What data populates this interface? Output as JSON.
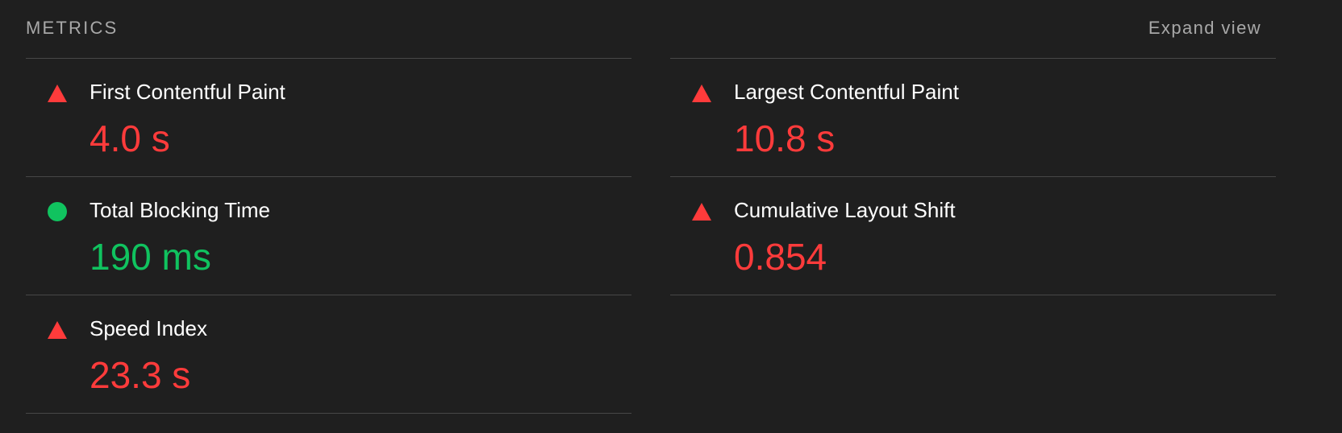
{
  "header": {
    "title": "METRICS",
    "expand_label": "Expand view"
  },
  "colors": {
    "fail": "#ff3b3b",
    "pass": "#10c35f",
    "background": "#1f1f1f",
    "divider": "#474747"
  },
  "left_metrics": [
    {
      "label": "First Contentful Paint",
      "value": "4.0 s",
      "status": "fail",
      "icon": "triangle-warning-icon"
    },
    {
      "label": "Total Blocking Time",
      "value": "190 ms",
      "status": "pass",
      "icon": "circle-pass-icon"
    },
    {
      "label": "Speed Index",
      "value": "23.3 s",
      "status": "fail",
      "icon": "triangle-warning-icon"
    }
  ],
  "right_metrics": [
    {
      "label": "Largest Contentful Paint",
      "value": "10.8 s",
      "status": "fail",
      "icon": "triangle-warning-icon"
    },
    {
      "label": "Cumulative Layout Shift",
      "value": "0.854",
      "status": "fail",
      "icon": "triangle-warning-icon"
    }
  ]
}
